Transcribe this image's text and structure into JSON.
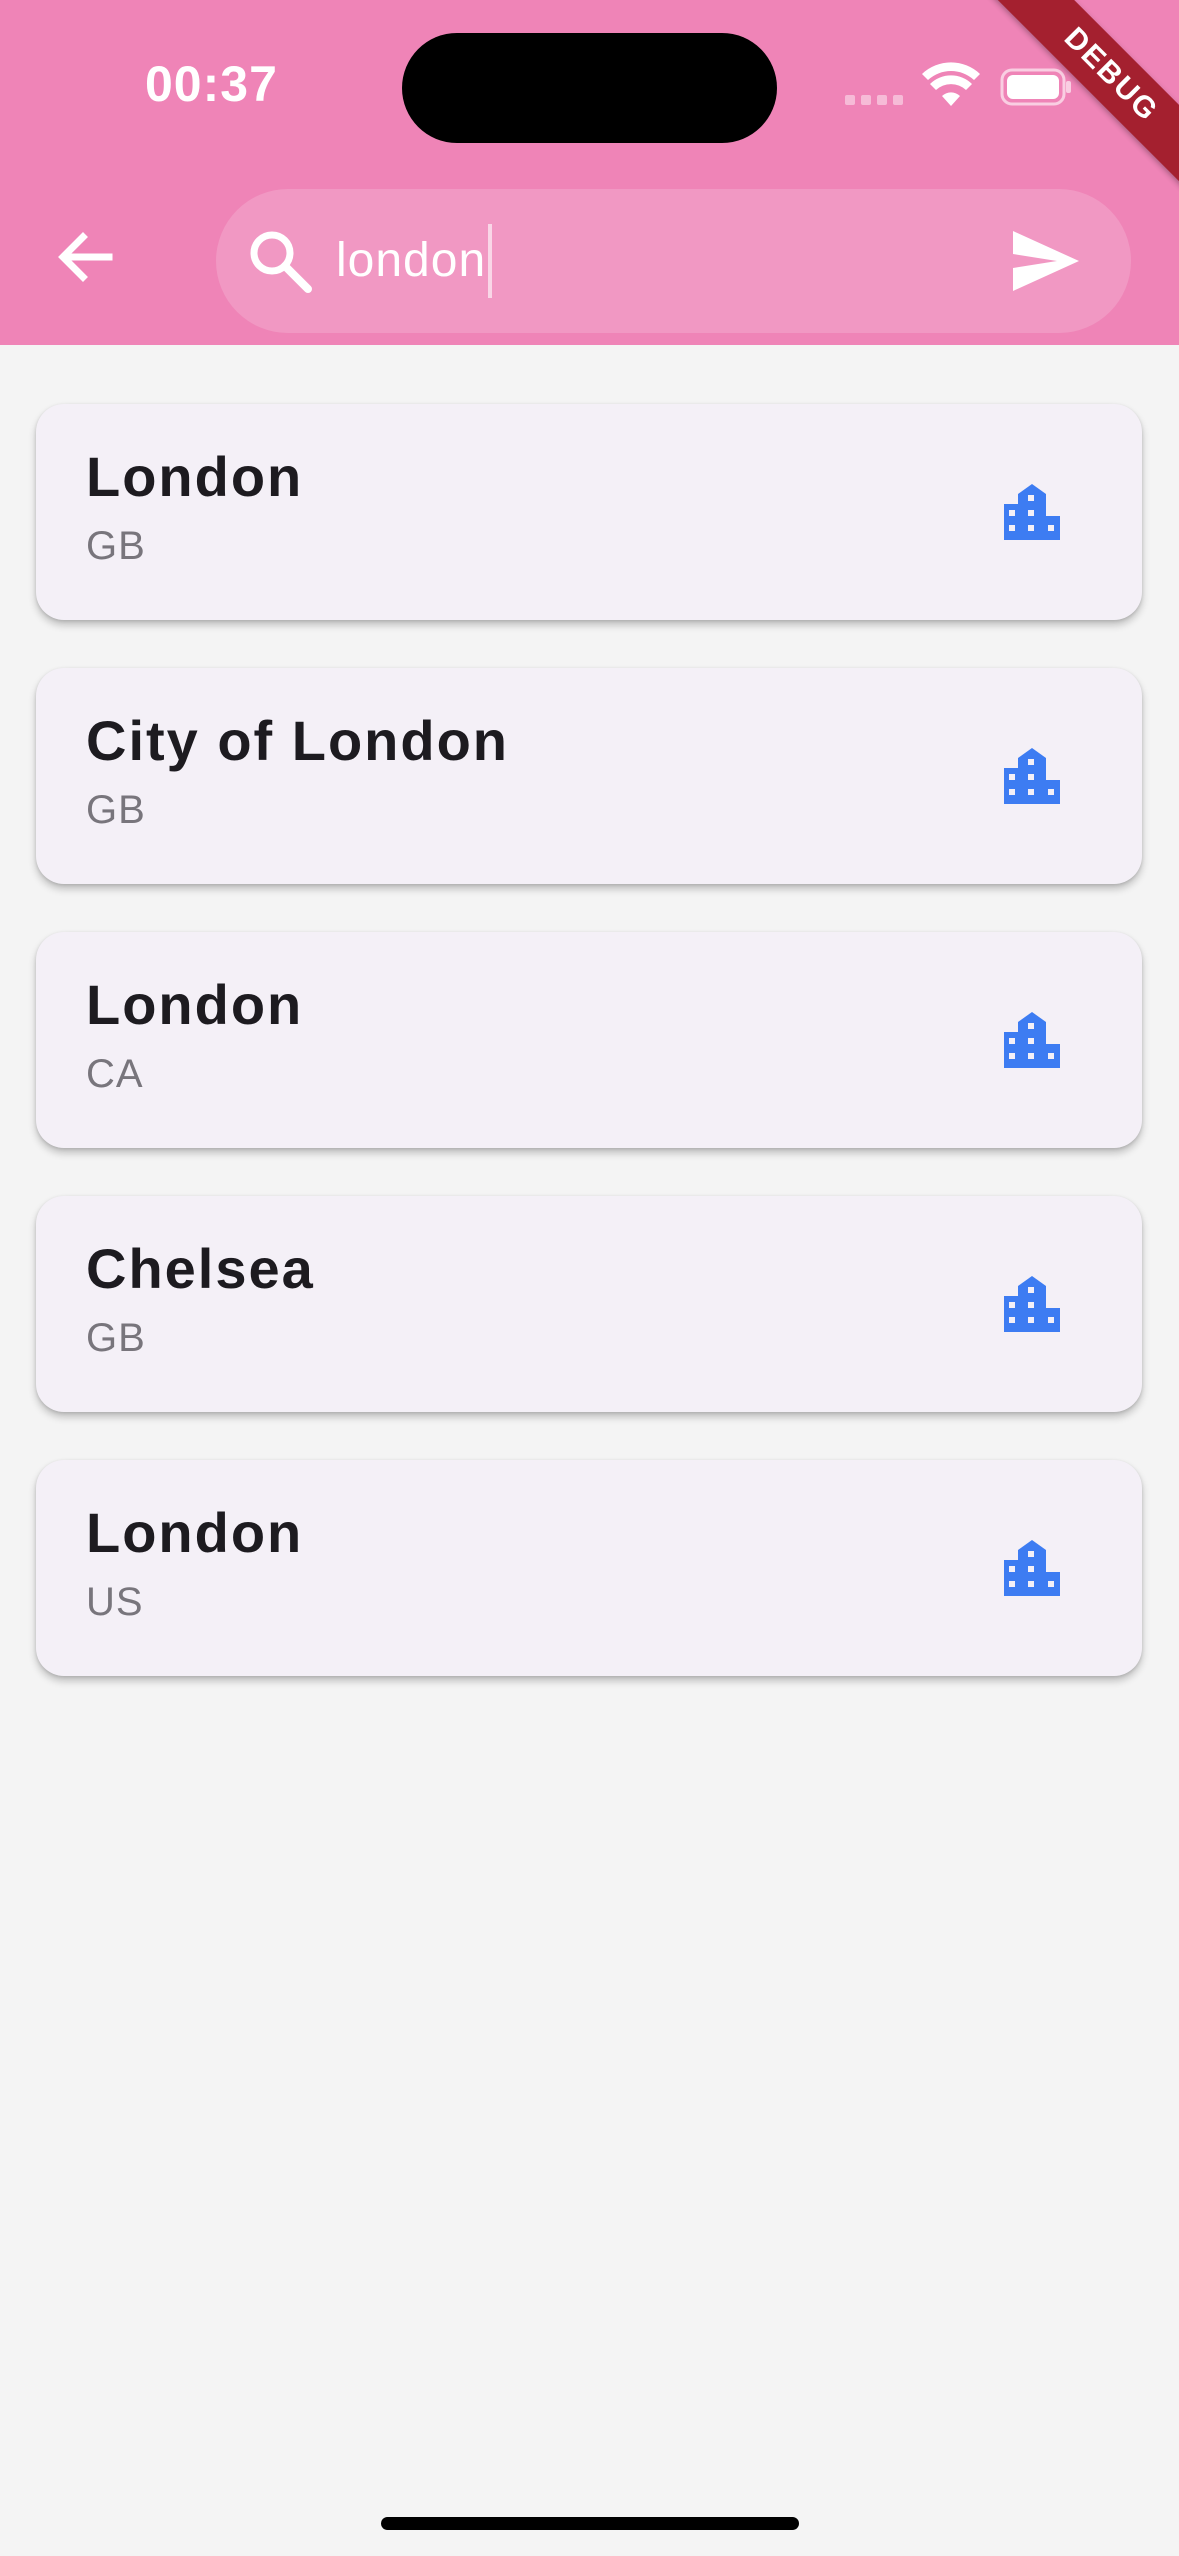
{
  "status_bar": {
    "time": "00:37",
    "debug_label": "DEBUG"
  },
  "search": {
    "query": "london"
  },
  "colors": {
    "app_bar": "#ef84b7",
    "card_background": "#f4f0f7",
    "city_icon": "#3d7cf2",
    "debug_ribbon": "#a4202f"
  },
  "results": [
    {
      "name": "London",
      "country": "GB",
      "icon": "location-city-icon"
    },
    {
      "name": "City of London",
      "country": "GB",
      "icon": "location-city-icon"
    },
    {
      "name": "London",
      "country": "CA",
      "icon": "location-city-icon"
    },
    {
      "name": "Chelsea",
      "country": "GB",
      "icon": "location-city-icon"
    },
    {
      "name": "London",
      "country": "US",
      "icon": "location-city-icon"
    }
  ]
}
